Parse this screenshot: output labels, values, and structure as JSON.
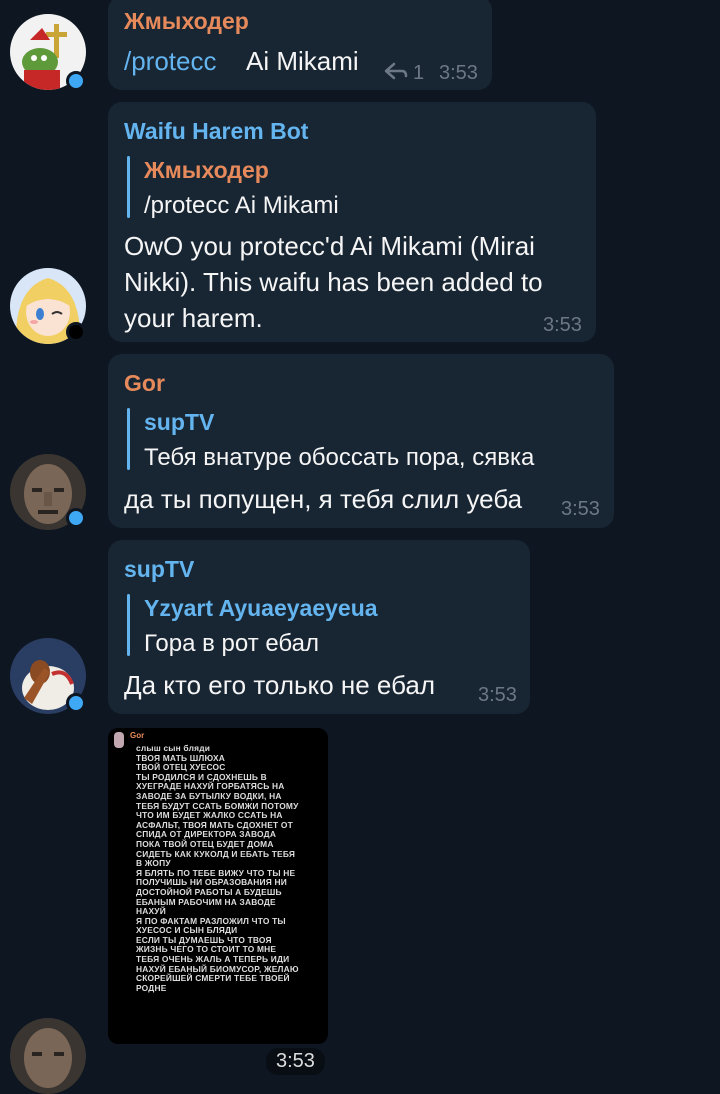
{
  "messages": [
    {
      "sender": "Жмыходер",
      "sender_color": "#e78a5b",
      "text_cmd": "/protecc",
      "text_arg": "Ai Mikami",
      "replies": "1",
      "time": "3:53"
    },
    {
      "sender": "Waifu Harem Bot",
      "sender_color": "#64b5ef",
      "quote_name": "Жмыходер",
      "quote_name_color": "#e78a5b",
      "quote_text": "/protecc  Ai Mikami",
      "text_lines": [
        "OwO you protecc'd Ai Mikami (Mirai",
        "Nikki). This waifu has been added to",
        "your harem."
      ],
      "time": "3:53"
    },
    {
      "sender": "Gor",
      "sender_color": "#e78a5b",
      "quote_name": "supTV",
      "quote_text": "Тебя внатуре обоссать пора, сявка",
      "text": "да ты попущен, я тебя слил уеба",
      "time": "3:53"
    },
    {
      "sender": "supTV",
      "sender_color": "#64b5ef",
      "quote_name": "Yzyart Ayuaeyaeyeua",
      "quote_text": "Гора в рот ебал",
      "text": "Да кто его только не ебал",
      "time": "3:53"
    }
  ],
  "photo": {
    "sender": "Gor",
    "text": "слыш сын бляди\nТВОЯ МАТЬ ШЛЮХА\nТВОЙ ОТЕЦ ХУЕСОС\nТЫ РОДИЛСЯ И СДОХНЕШЬ В\nХУЕГРАДЕ НАХУЙ ГОРБАТЯСЬ НА\nЗАВОДЕ ЗА БУТЫЛКУ ВОДКИ, НА\nТЕБЯ БУДУТ ССАТЬ БОМЖИ ПОТОМУ\nЧТО ИМ БУДЕТ ЖАЛКО ССАТЬ НА\nАСФАЛЬТ, ТВОЯ МАТЬ СДОХНЕТ ОТ\nСПИДА ОТ ДИРЕКТОРА ЗАВОДА\nПОКА ТВОЙ ОТЕЦ БУДЕТ ДОМА\nСИДЕТЬ КАК КУКОЛД И ЕБАТЬ ТЕБЯ\nВ ЖОПУ\nЯ БЛЯТЬ ПО ТЕБЕ ВИЖУ ЧТО ТЫ НЕ\nПОЛУЧИШЬ НИ ОБРАЗОВАНИЯ НИ\nДОСТОЙНОЙ РАБОТЫ А БУДЕШЬ\nЕБАНЫМ РАБОЧИМ НА ЗАВОДЕ\nНАХУЙ\nЯ ПО ФАКТАМ РАЗЛОЖИЛ ЧТО ТЫ\nХУЕСОС И СЫН БЛЯДИ\nЕСЛИ ТЫ ДУМАЕШЬ ЧТО ТВОЯ\nЖИЗНЬ ЧЕГО ТО СТОИТ ТО МНЕ\nТЕБЯ ОЧЕНЬ ЖАЛЬ А ТЕПЕРЬ ИДИ\nНАХУЙ ЕБАНЫЙ БИОМУСОР, ЖЕЛАЮ\nСКОРЕЙШЕЙ СМЕРТИ ТЕБЕ  ТВОЕЙ\nРОДНЕ",
    "time": "3:53"
  },
  "icons": {
    "reply": "reply-arrow-icon"
  }
}
